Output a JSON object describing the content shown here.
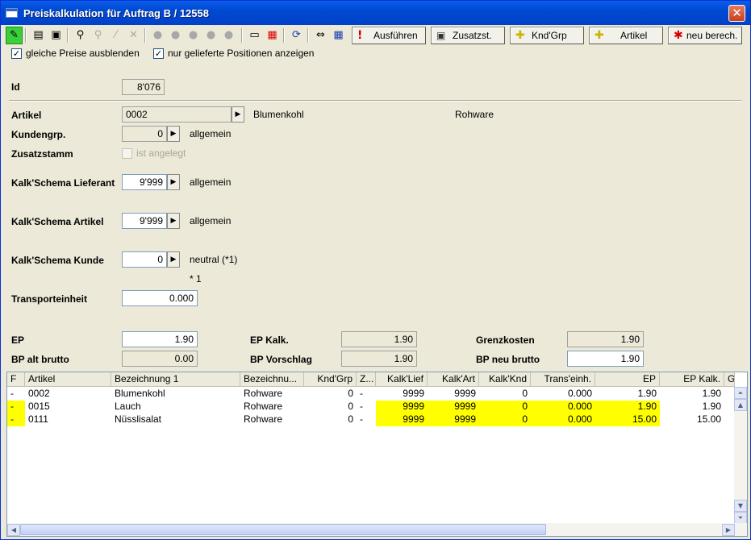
{
  "window": {
    "title": "Preiskalkulation für Auftrag B / 12558"
  },
  "toolbar": {
    "icons": [
      "pencil-icon",
      "printer-icon",
      "save-icon",
      "binoculars-icon",
      "search-icon",
      "wand-icon",
      "delete-icon",
      "circle-icon",
      "circle-icon",
      "circle-icon",
      "circle-icon",
      "circle-icon",
      "minus-icon",
      "table-delete-icon",
      "refresh-icon",
      "resize-icon",
      "calendar-icon"
    ],
    "buttons": {
      "ausfuehren": "Ausführen",
      "zusatzst": "Zusatzst.",
      "kndgrp": "Knd'Grp",
      "artikel": "Artikel",
      "neu_berech": "neu berech."
    }
  },
  "options": {
    "hide_same_prices": {
      "label": "gleiche Preise ausblenden",
      "checked": true
    },
    "only_delivered": {
      "label": "nur gelieferte Positionen anzeigen",
      "checked": true
    }
  },
  "form": {
    "id_label": "Id",
    "id_value": "8'076",
    "artikel_label": "Artikel",
    "artikel_value": "0002",
    "artikel_name": "Blumenkohl",
    "artikel_type": "Rohware",
    "kundengrp_label": "Kundengrp.",
    "kundengrp_value": "0",
    "kundengrp_text": "allgemein",
    "zusatzstamm_label": "Zusatzstamm",
    "zusatzstamm_chk": "ist angelegt",
    "ks_lieferant_label": "Kalk'Schema Lieferant",
    "ks_lieferant_value": "9'999",
    "ks_lieferant_text": "allgemein",
    "ks_artikel_label": "Kalk'Schema Artikel",
    "ks_artikel_value": "9'999",
    "ks_artikel_text": "allgemein",
    "ks_kunde_label": "Kalk'Schema Kunde",
    "ks_kunde_value": "0",
    "ks_kunde_text": "neutral (*1)",
    "footnote": "* 1",
    "transport_label": "Transporteinheit",
    "transport_value": "0.000",
    "ep_label": "EP",
    "ep_value": "1.90",
    "ep_kalk_label": "EP Kalk.",
    "ep_kalk_value": "1.90",
    "grenzkosten_label": "Grenzkosten",
    "grenzkosten_value": "1.90",
    "bp_alt_label": "BP alt brutto",
    "bp_alt_value": "0.00",
    "bp_vorschlag_label": "BP Vorschlag",
    "bp_vorschlag_value": "1.90",
    "bp_neu_label": "BP neu brutto",
    "bp_neu_value": "1.90"
  },
  "grid": {
    "columns": [
      "F",
      "Artikel",
      "Bezeichnung 1",
      "Bezeichnu...",
      "Knd'Grp",
      "Z...",
      "Kalk'Lief",
      "Kalk'Art",
      "Kalk'Knd",
      "Trans'einh.",
      "EP",
      "EP Kalk.",
      "G"
    ],
    "rows": [
      {
        "f": "-",
        "artikel": "0002",
        "bez1": "Blumenkohl",
        "bez2": "Rohware",
        "kndgrp": "0",
        "z": "-",
        "kalk_lief": "9999",
        "kalk_art": "9999",
        "kalk_knd": "0",
        "trans": "0.000",
        "ep": "1.90",
        "ep_kalk": "1.90",
        "highlight": false
      },
      {
        "f": "-",
        "artikel": "0015",
        "bez1": "Lauch",
        "bez2": "Rohware",
        "kndgrp": "0",
        "z": "-",
        "kalk_lief": "9999",
        "kalk_art": "9999",
        "kalk_knd": "0",
        "trans": "0.000",
        "ep": "1.90",
        "ep_kalk": "1.90",
        "highlight": true
      },
      {
        "f": "-",
        "artikel": "0111",
        "bez1": "Nüsslisalat",
        "bez2": "Rohware",
        "kndgrp": "0",
        "z": "-",
        "kalk_lief": "9999",
        "kalk_art": "9999",
        "kalk_knd": "0",
        "trans": "0.000",
        "ep": "15.00",
        "ep_kalk": "15.00",
        "highlight": true
      }
    ],
    "highlight_color": "#ffff00"
  }
}
